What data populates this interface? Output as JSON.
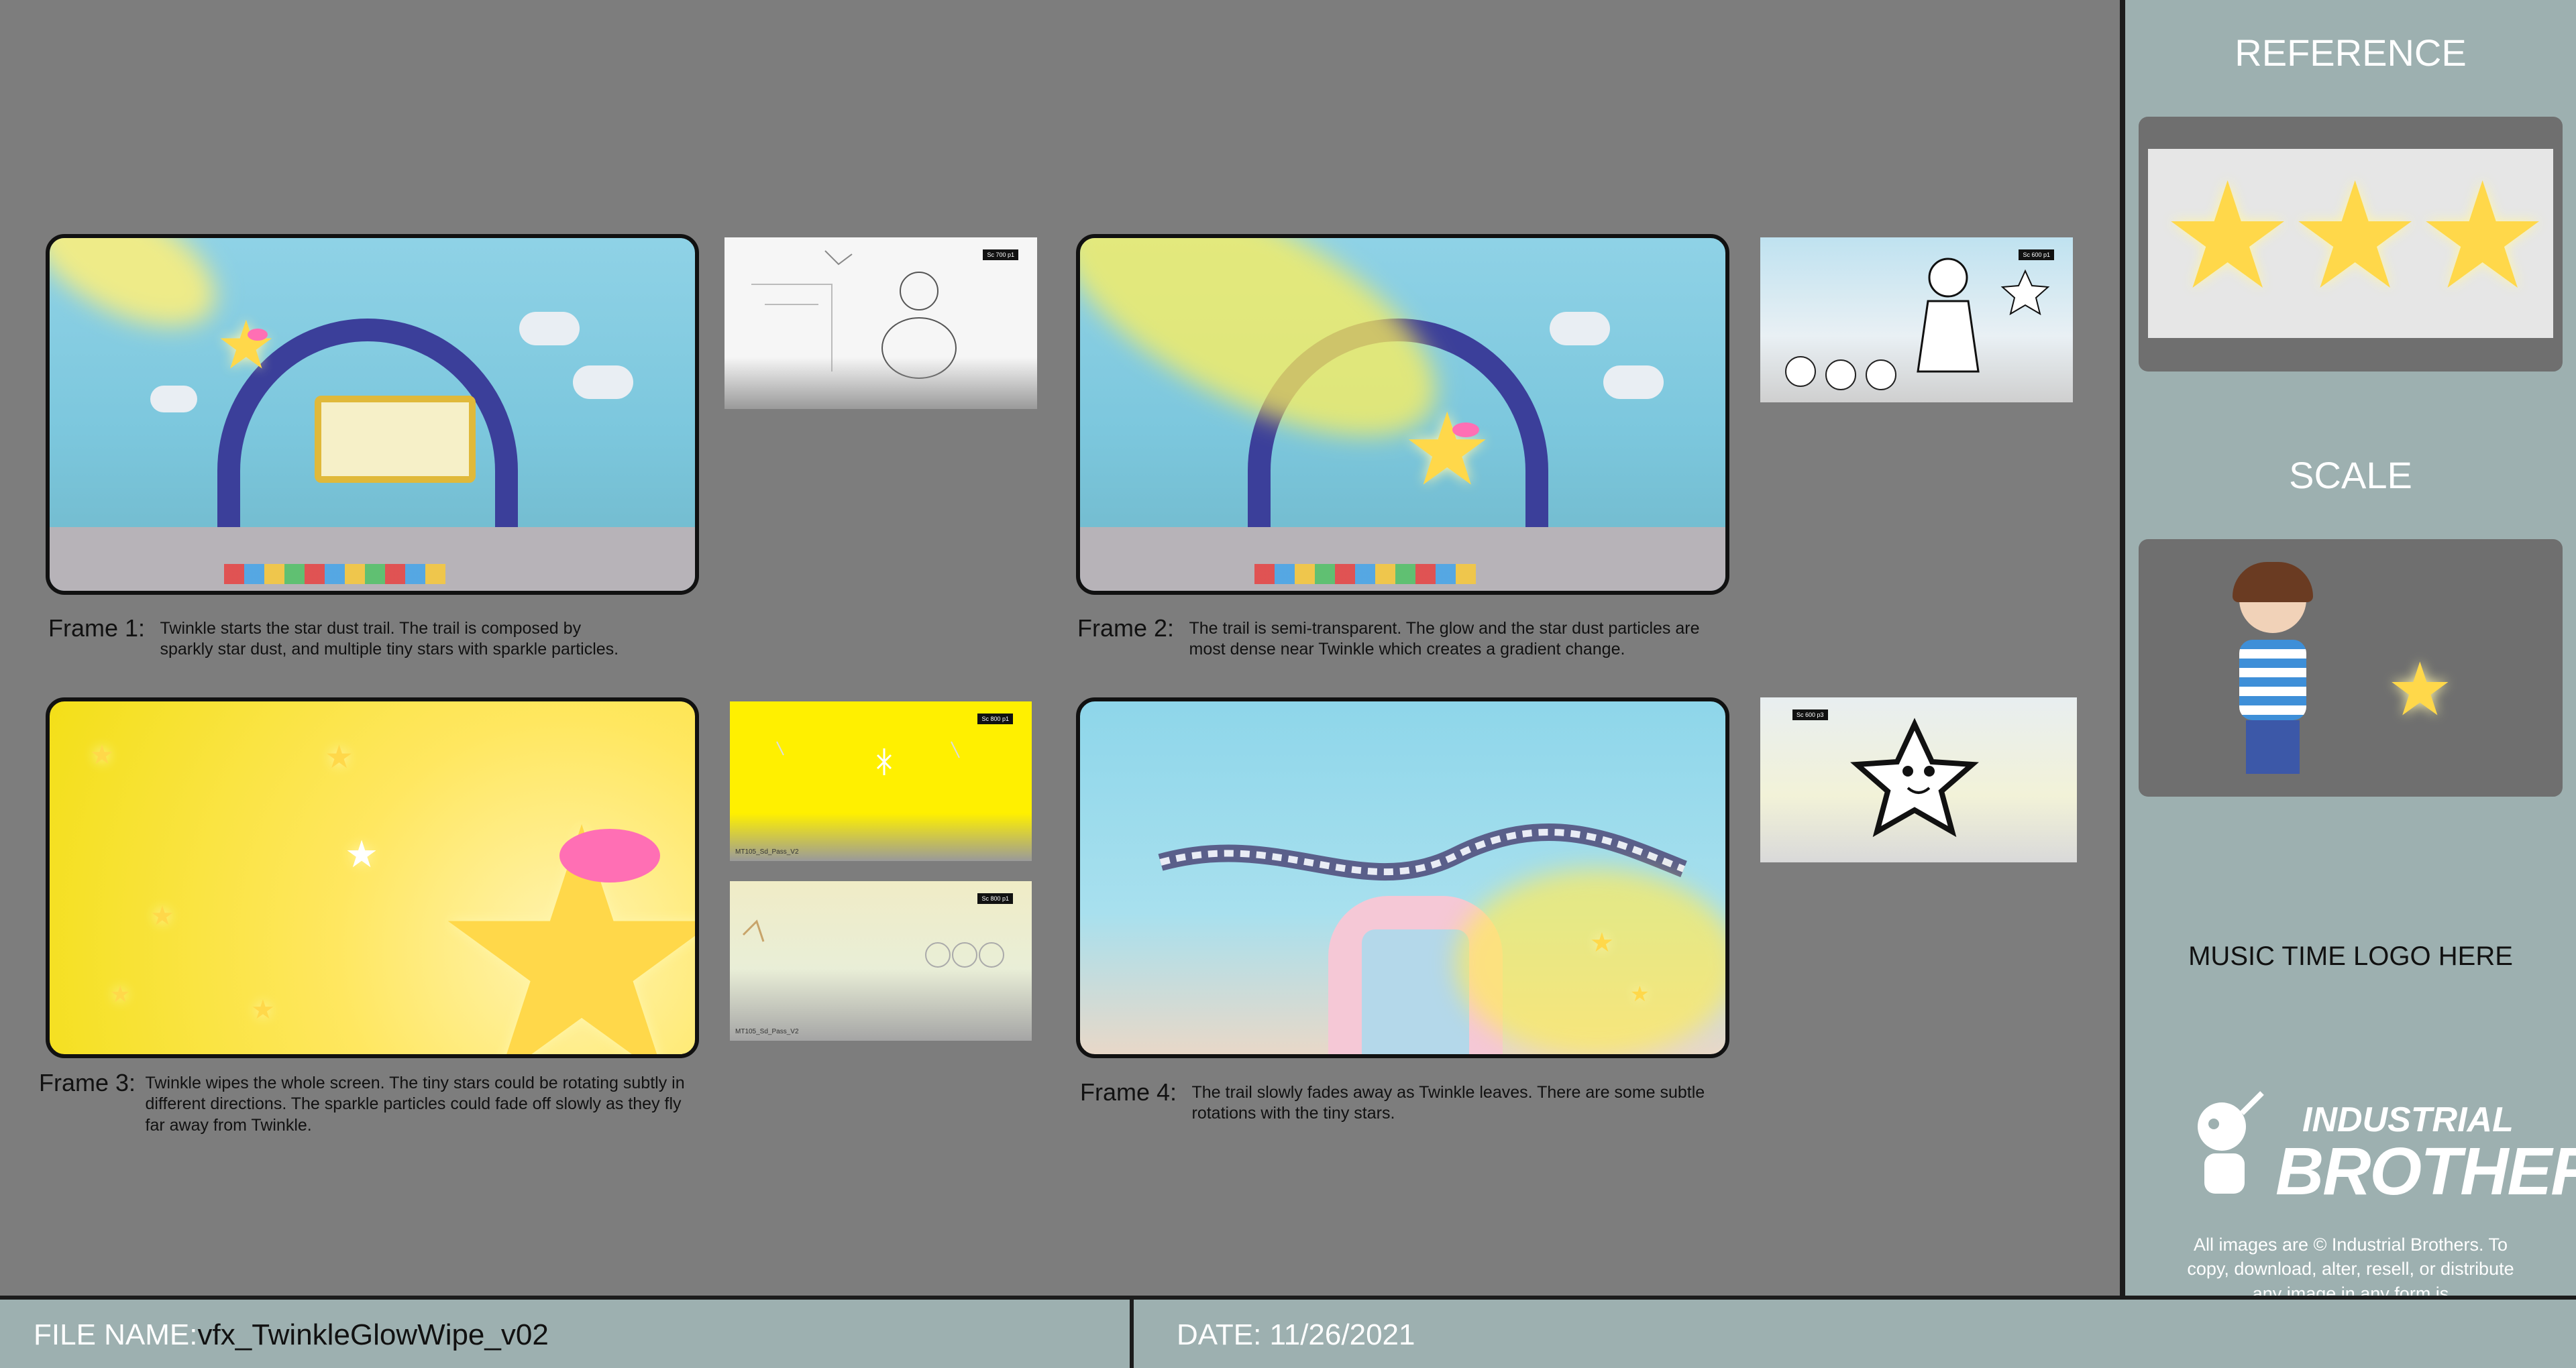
{
  "sidebar": {
    "reference_title": "REFERENCE",
    "scale_title": "SCALE",
    "logo_placeholder": "MUSIC TIME LOGO HERE",
    "brand": {
      "line1": "INDUSTRIAL",
      "line2": "BROTHERS"
    },
    "copyright": "All images are © Industrial Brothers. To copy, download, alter, resell, or distribute any image in any form is"
  },
  "footer": {
    "file_label": "FILE NAME:",
    "file_value": "vfx_TwinkleGlowWipe_v02",
    "date_label": "DATE: 11/26/2021"
  },
  "frames": [
    {
      "title": "Frame 1:",
      "body": "Twinkle starts the star dust trail. The trail is composed by sparkly star dust, and multiple tiny stars with sparkle particles."
    },
    {
      "title": "Frame 2:",
      "body": "The trail is semi-transparent. The glow and the star dust particles are most dense near Twinkle which creates a gradient change."
    },
    {
      "title": "Frame 3:",
      "body": "Twinkle wipes the whole screen. The tiny stars could be rotating subtly in different directions. The sparkle particles could fade off slowly as they fly far away from Twinkle."
    },
    {
      "title": "Frame 4:",
      "body": "The trail slowly fades away as Twinkle leaves. There are some subtle rotations with the tiny stars."
    }
  ],
  "thumbs": {
    "t1_tag": "Sc 700 p1",
    "t2_tag": "Sc 600 p1",
    "t3_tag": "Sc 800 p1",
    "t3_label": "MT105_Sd_Pass_V2",
    "t4_tag": "Sc 800 p1",
    "t4_label": "MT105_Sd_Pass_V2",
    "t5_tag": "Sc 600 p3"
  },
  "colors": {
    "panel": "#7d7d7d",
    "sidebar": "#9db0b0",
    "arch": "#3b3f9a",
    "twinkle": "#ffd84a",
    "bow": "#ff6fb4"
  }
}
